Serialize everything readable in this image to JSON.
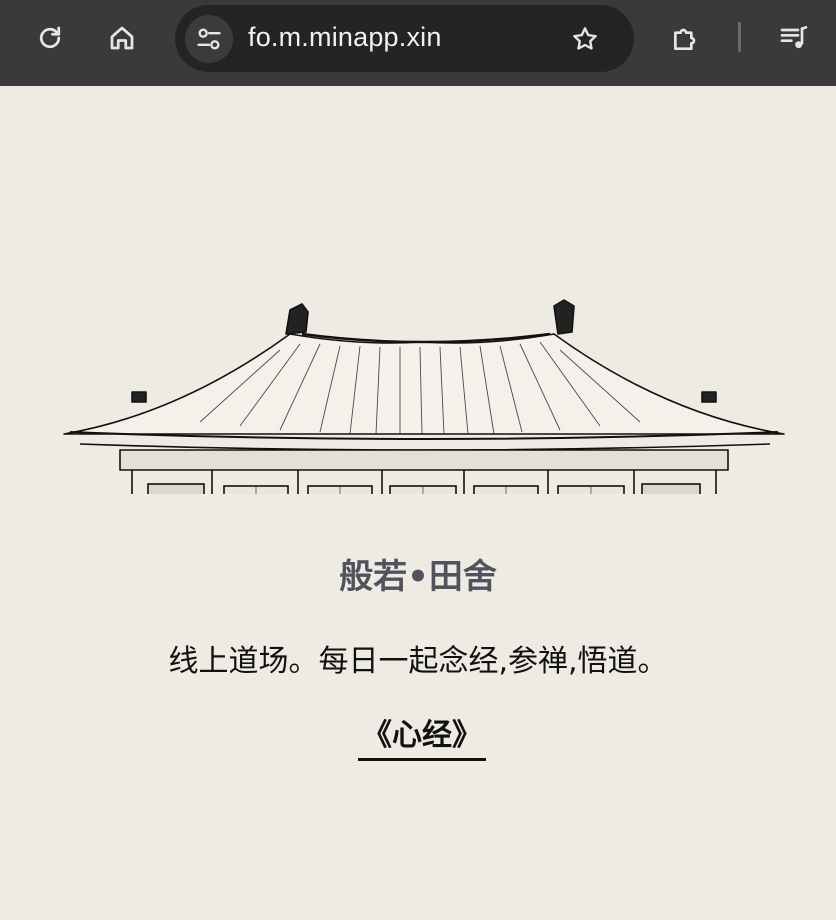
{
  "browser": {
    "url": "fo.m.minapp.xin"
  },
  "page": {
    "title": "般若•田舍",
    "tagline": "线上道场。每日一起念经,参禅,悟道。",
    "link_label": "《心经》"
  },
  "colors": {
    "toolbar_bg": "#3a3a3a",
    "url_pill_bg": "#242424",
    "page_bg": "#eeebe3",
    "title_color": "#50535c",
    "text_color": "#111111"
  }
}
